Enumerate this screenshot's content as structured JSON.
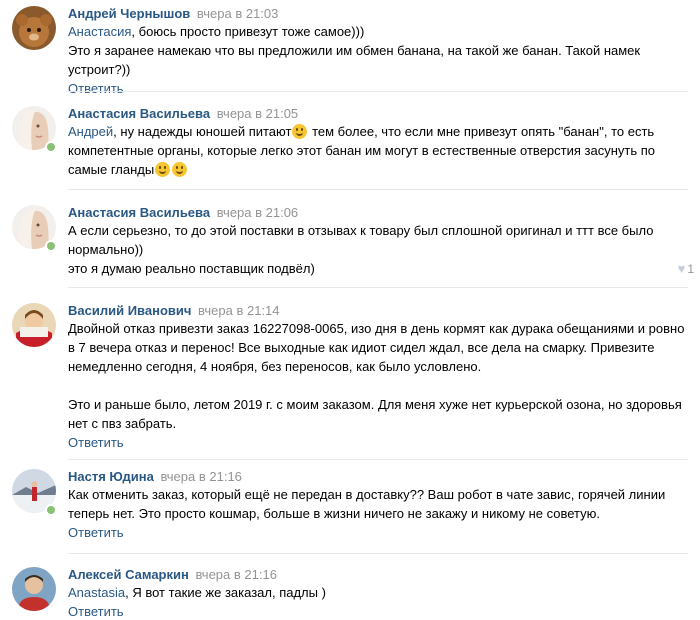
{
  "colors": {
    "link": "#2a5885",
    "time": "#939393",
    "separator": "#e7e8ec",
    "online": "#8ac176"
  },
  "comments": [
    {
      "author": "Андрей Чернышов",
      "time": "вчера в 21:03",
      "mention": "Анастасия",
      "line1": ", боюсь просто привезут тоже самое)))",
      "line2": "Это я заранее намекаю что вы предложили им обмен банана, на такой же банан. Такой намек устроит?))",
      "reply": "Ответить"
    },
    {
      "author": "Анастасия Васильева",
      "time": "вчера в 21:05",
      "mention": "Андрей",
      "part1": ", ну надежды юношей питают",
      "part2": " тем более, что если мне привезут опять \"банан\", то есть компетентные органы, которые легко этот банан им могут в естественные отверстия засунуть по самые гланды"
    },
    {
      "author": "Анастасия Васильева",
      "time": "вчера в 21:06",
      "line1": "А если серьезно, то до этой поставки в отзывах к товару был сплошной оригинал и ттт все было нормально))",
      "line2": "это я думаю реально поставщик подвёл)",
      "likes": "1"
    },
    {
      "author": "Василий Иванович",
      "time": "вчера в 21:14",
      "para1": "Двойной отказ привезти заказ 16227098-0065, изо дня в день кормят как дурака обещаниями и ровно в 7 вечера отказ и перенос! Все выходные как идиот сидел ждал, все дела на смарку. Привезите немедленно сегодня, 4 ноября, без переносов, как было условлено.",
      "para2": "Это и раньше было, летом 2019 г. с моим заказом. Для меня хуже нет курьерской озона, но здоровья нет с пвз забрать.",
      "reply": "Ответить"
    },
    {
      "author": "Настя Юдина",
      "time": "вчера в 21:16",
      "text": "Как отменить заказ, который ещё не передан в доставку?? Ваш робот в чате завис, горячей линии теперь нет. Это просто кошмар, больше в жизни ничего не закажу и никому не советую.",
      "reply": "Ответить"
    },
    {
      "author": "Алексей Самаркин",
      "time": "вчера в 21:16",
      "mention": "Anastasia",
      "text": ", Я вот такие же заказал, падлы )",
      "reply": "Ответить"
    }
  ]
}
